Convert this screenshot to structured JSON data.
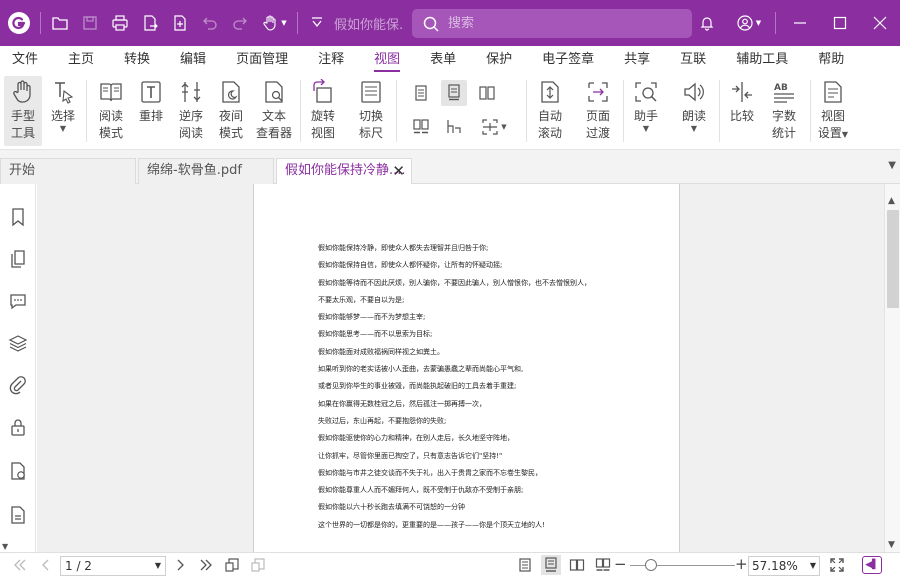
{
  "titlebar": {
    "doc_title": "假如你能保...",
    "search_placeholder": "搜索"
  },
  "menu": {
    "items": [
      "文件",
      "主页",
      "转换",
      "编辑",
      "页面管理",
      "注释",
      "视图",
      "表单",
      "保护",
      "电子签章",
      "共享",
      "互联",
      "辅助工具",
      "帮助"
    ],
    "active": "视图"
  },
  "ribbon": {
    "hand_tool": [
      "手型",
      "工具"
    ],
    "select": "选择",
    "read_mode": [
      "阅读",
      "模式"
    ],
    "reflow": "重排",
    "reverse_read": [
      "逆序",
      "阅读"
    ],
    "night_mode": [
      "夜间",
      "模式"
    ],
    "text_viewer": [
      "文本",
      "查看器"
    ],
    "rotate_view": [
      "旋转",
      "视图"
    ],
    "toggle_ruler": [
      "切换",
      "标尺"
    ],
    "auto_scroll": [
      "自动",
      "滚动"
    ],
    "page_transition": [
      "页面",
      "过渡"
    ],
    "assistant": "助手",
    "read_aloud": "朗读",
    "compare": "比较",
    "word_count": [
      "字数",
      "统计"
    ],
    "view_settings": [
      "视图",
      "设置"
    ]
  },
  "tabs": [
    {
      "label": "开始"
    },
    {
      "label": "绵绵-软骨鱼.pdf"
    },
    {
      "label": "假如你能保持冷静...."
    }
  ],
  "document": {
    "lines": [
      "假如你能保持冷静，即使众人都失去理智并且归咎于你;",
      "假如你能保持自信，即使众人都怀疑你，让所有的怀疑动摇;",
      "假如你能等待而不因此厌烦，别人骗你，不要因此骗人，别人憎恨你，也不去憎恨别人，",
      "不要太乐观，不要自以为是;",
      "假如你能够梦——而不为梦想主宰;",
      "假如你能思考——而不以思索为目标;",
      "假如你能面对成败福祸同样视之如粪土。",
      "如果听到你的老实话被小人歪曲，去蒙骗愚蠢之辈而尚能心平气和,",
      "或者见到你毕生的事业被毁，而尚能执起破旧的工具去着手重建;",
      "如果在你赢得无数桂冠之后，然后孤注一掷再搏一次，",
      "失败过后，东山再起，不要抱怨你的失败;",
      "假如你能驱使你的心力和精神，在别人走后，长久地坚守阵地，",
      "让你抓牢，尽管你里面已掏空了，只有意志告诉它们\"坚持!\"",
      "假如你能与市井之徒交谈而不失于礼，出入于贵胄之家而不忘卷生黎民，",
      "假如你能尊重人人而不媚拜何人，既不受制于仇敌亦不受制于亲朋;",
      "假如你能以六十秒长跑去填满不可饶恕的一分钟",
      "这个世界的一切都是你的，更重要的是——孩子——你是个顶天立地的人!"
    ]
  },
  "statusbar": {
    "page_indicator": "1 / 2",
    "zoom_value": "57.18%",
    "zoom_level": 0.2,
    "zoom_out_label": "−",
    "zoom_in_label": "+"
  }
}
